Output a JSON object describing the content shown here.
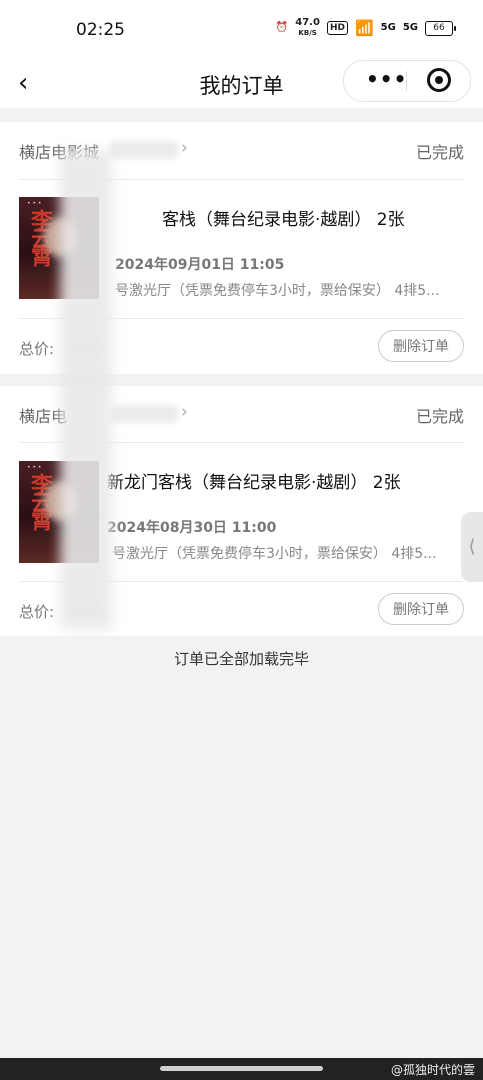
{
  "statusbar": {
    "time": "02:25",
    "speed_value": "47.0",
    "speed_unit": "KB/S",
    "hd": "HD",
    "net1": "5G",
    "net2": "5G",
    "battery": "66"
  },
  "nav": {
    "back_icon": "chevron-left-icon",
    "title": "我的订单",
    "more_icon": "more-dots-icon",
    "close_icon": "target-icon"
  },
  "orders": [
    {
      "cinema": "横店电影城",
      "status": "已完成",
      "title": "客栈（舞台纪录电影·越剧） 2张",
      "time": "2024年09月01日 11:05",
      "hall": "号激光厅（凭票免费停车3小时，票给保安） 4排5...",
      "total_label": "总价:",
      "delete_label": "删除订单",
      "poster_title": "李云霄"
    },
    {
      "cinema": "横店电",
      "status": "已完成",
      "title": "新龙门客栈（舞台纪录电影·越剧） 2张",
      "time": "2024年08月30日 11:00",
      "hall": "号激光厅（凭票免费停车3小时，票给保安） 4排5...",
      "total_label": "总价:",
      "delete_label": "删除订单",
      "poster_title": "李云霄"
    }
  ],
  "footer_text": "订单已全部加载完毕",
  "side_handle": "⟨",
  "watermark": "@孤独时代的雲"
}
